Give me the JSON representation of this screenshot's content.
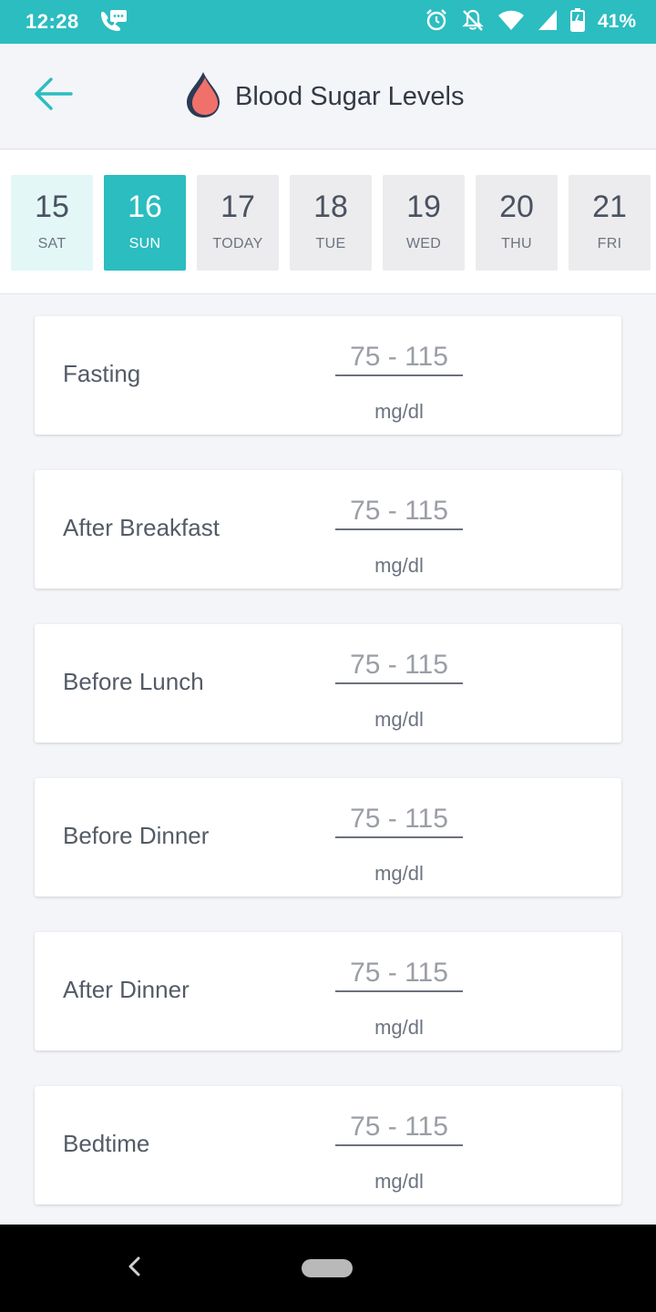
{
  "status_bar": {
    "time": "12:28",
    "battery": "41%",
    "icons": [
      "message-icon",
      "alarm-icon",
      "notifications-off-icon",
      "wifi-icon",
      "signal-icon",
      "battery-icon"
    ],
    "color": "#2bbdc0"
  },
  "header": {
    "title": "Blood Sugar Levels",
    "back_icon": "arrow-left-icon",
    "logo_icon": "blood-drop-icon"
  },
  "date_strip": {
    "dates": [
      {
        "num": "15",
        "day": "SAT",
        "state": "past"
      },
      {
        "num": "16",
        "day": "SUN",
        "state": "selected"
      },
      {
        "num": "17",
        "day": "TODAY",
        "state": "default"
      },
      {
        "num": "18",
        "day": "TUE",
        "state": "default"
      },
      {
        "num": "19",
        "day": "WED",
        "state": "default"
      },
      {
        "num": "20",
        "day": "THU",
        "state": "default"
      },
      {
        "num": "21",
        "day": "FRI",
        "state": "default"
      }
    ],
    "accent_color": "#2bbdc0"
  },
  "readings": [
    {
      "label": "Fasting",
      "placeholder": "75 - 115",
      "unit": "mg/dl"
    },
    {
      "label": "After Breakfast",
      "placeholder": "75 - 115",
      "unit": "mg/dl"
    },
    {
      "label": "Before Lunch",
      "placeholder": "75 - 115",
      "unit": "mg/dl"
    },
    {
      "label": "Before Dinner",
      "placeholder": "75 - 115",
      "unit": "mg/dl"
    },
    {
      "label": "After Dinner",
      "placeholder": "75 - 115",
      "unit": "mg/dl"
    },
    {
      "label": "Bedtime",
      "placeholder": "75 - 115",
      "unit": "mg/dl"
    }
  ],
  "nav_bar": {
    "back_icon": "nav-back-icon",
    "home_icon": "nav-home-pill"
  }
}
